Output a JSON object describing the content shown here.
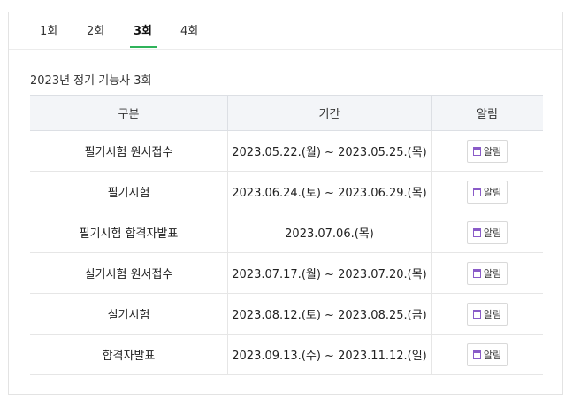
{
  "tabs": [
    {
      "label": "1회",
      "active": false
    },
    {
      "label": "2회",
      "active": false
    },
    {
      "label": "3회",
      "active": true
    },
    {
      "label": "4회",
      "active": false
    }
  ],
  "accent_color": "#2fb35a",
  "section_title": "2023년 정기 기능사 3회",
  "table": {
    "headers": [
      "구분",
      "기간",
      "알림"
    ],
    "rows": [
      {
        "division": "필기시험 원서접수",
        "period": "2023.05.22.(월) ~ 2023.05.25.(목)",
        "alarm": "알림"
      },
      {
        "division": "필기시험",
        "period": "2023.06.24.(토) ~ 2023.06.29.(목)",
        "alarm": "알림"
      },
      {
        "division": "필기시험 합격자발표",
        "period": "2023.07.06.(목)",
        "alarm": "알림"
      },
      {
        "division": "실기시험 원서접수",
        "period": "2023.07.17.(월) ~ 2023.07.20.(목)",
        "alarm": "알림"
      },
      {
        "division": "실기시험",
        "period": "2023.08.12.(토) ~ 2023.08.25.(금)",
        "alarm": "알림"
      },
      {
        "division": "합격자발표",
        "period": "2023.09.13.(수) ~ 2023.11.12.(일)",
        "alarm": "알림"
      }
    ]
  },
  "icons": {
    "alarm": "calendar-icon"
  }
}
